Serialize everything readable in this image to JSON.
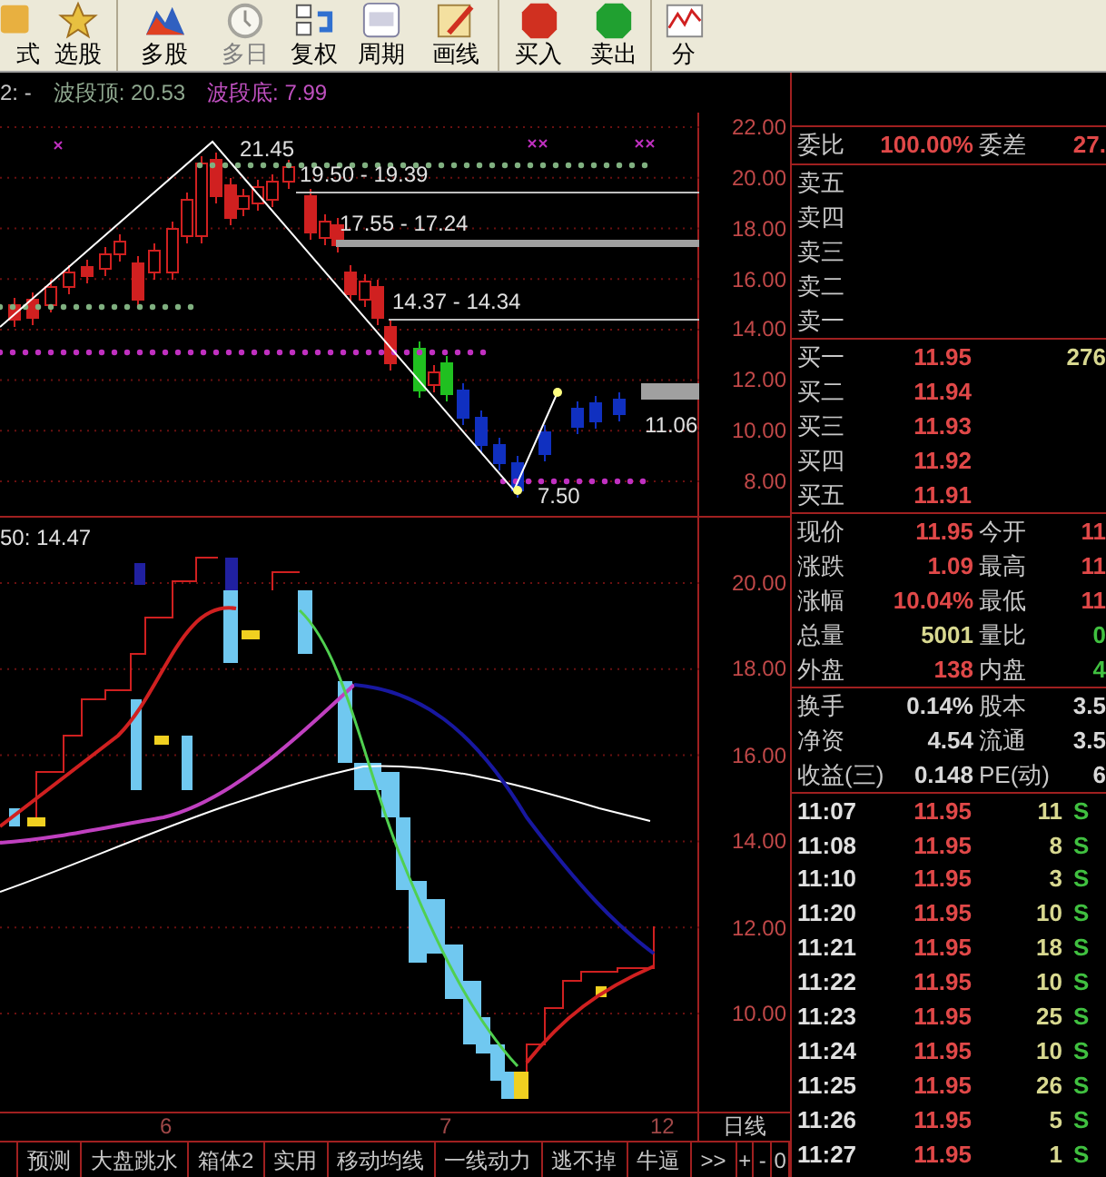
{
  "toolbar": [
    {
      "label": "式",
      "kind": "formula",
      "disabled": false
    },
    {
      "label": "选股",
      "kind": "pick",
      "disabled": false
    },
    {
      "label": "多股",
      "kind": "multi",
      "disabled": false
    },
    {
      "label": "多日",
      "kind": "days",
      "disabled": true
    },
    {
      "label": "复权",
      "kind": "restore",
      "disabled": false
    },
    {
      "label": "周期",
      "kind": "period",
      "disabled": false
    },
    {
      "label": "画线",
      "kind": "draw",
      "disabled": false
    },
    {
      "label": "买入",
      "kind": "buy",
      "disabled": false
    },
    {
      "label": "卖出",
      "kind": "sell",
      "disabled": false
    },
    {
      "label": "分",
      "kind": "timeshare",
      "disabled": false
    }
  ],
  "indicator_header": {
    "prefix": "2: -",
    "items": [
      {
        "label": "波段顶: 20.53",
        "color": "#8fa88f"
      },
      {
        "label": "波段底: 7.99",
        "color": "#c050c0"
      }
    ]
  },
  "price_chart": {
    "y_axis": [
      "22.00",
      "20.00",
      "18.00",
      "16.00",
      "14.00",
      "12.00",
      "10.00",
      "8.00"
    ],
    "labels": [
      {
        "text": "21.45"
      },
      {
        "text": "19.50 - 19.39"
      },
      {
        "text": "17.55 - 17.24"
      },
      {
        "text": "14.37 - 14.34"
      },
      {
        "text": "11.06"
      },
      {
        "text": "7.50"
      }
    ]
  },
  "ma_chart": {
    "header": "50: 14.47",
    "y_axis": [
      "20.00",
      "18.00",
      "16.00",
      "14.00",
      "12.00",
      "10.00"
    ],
    "x_axis": [
      "6",
      "7",
      "12"
    ]
  },
  "period": "日线",
  "tabs": [
    "预测",
    "大盘跳水",
    "箱体2",
    "实用",
    "移动均线",
    "一线动力",
    "逃不掉",
    "牛逼",
    ">>"
  ],
  "zoom_buttons": [
    "+",
    "-",
    "0"
  ],
  "quote": {
    "ratio": {
      "label": "委比",
      "value": "100.00%",
      "label2": "委差",
      "value2": "27."
    },
    "asks": [
      {
        "label": "卖五"
      },
      {
        "label": "卖四"
      },
      {
        "label": "卖三"
      },
      {
        "label": "卖二"
      },
      {
        "label": "卖一"
      }
    ],
    "bids": [
      {
        "label": "买一",
        "price": "11.95",
        "volume": "276"
      },
      {
        "label": "买二",
        "price": "11.94"
      },
      {
        "label": "买三",
        "price": "11.93"
      },
      {
        "label": "买四",
        "price": "11.92"
      },
      {
        "label": "买五",
        "price": "11.91"
      }
    ],
    "stats": [
      {
        "cells": [
          {
            "label": "现价",
            "value": "11.95",
            "color": "#e04848"
          },
          {
            "label": "今开",
            "value": "11",
            "color": "#e04848"
          }
        ]
      },
      {
        "cells": [
          {
            "label": "涨跌",
            "value": "1.09",
            "color": "#e04848"
          },
          {
            "label": "最高",
            "value": "11",
            "color": "#e04848"
          }
        ]
      },
      {
        "cells": [
          {
            "label": "涨幅",
            "value": "10.04%",
            "color": "#e04848"
          },
          {
            "label": "最低",
            "value": "11",
            "color": "#e04848"
          }
        ]
      },
      {
        "cells": [
          {
            "label": "总量",
            "value": "5001",
            "color": "#d8d890"
          },
          {
            "label": "量比",
            "value": "0",
            "color": "#40c040"
          }
        ]
      },
      {
        "cells": [
          {
            "label": "外盘",
            "value": "138",
            "color": "#e04848"
          },
          {
            "label": "内盘",
            "value": "4",
            "color": "#40c040"
          }
        ]
      }
    ],
    "finance": [
      {
        "label": "换手",
        "value": "0.14%",
        "label2": "股本",
        "value2": "3.5"
      },
      {
        "label": "净资",
        "value": "4.54",
        "label2": "流通",
        "value2": "3.5"
      },
      {
        "label": "收益(三)",
        "value": "0.148",
        "label2": "PE(动)",
        "value2": "6"
      }
    ],
    "trades": [
      {
        "time": "11:07",
        "price": "11.95",
        "volume": "11",
        "side": "S"
      },
      {
        "time": "11:08",
        "price": "11.95",
        "volume": "8",
        "side": "S"
      },
      {
        "time": "11:10",
        "price": "11.95",
        "volume": "3",
        "side": "S"
      },
      {
        "time": "11:20",
        "price": "11.95",
        "volume": "10",
        "side": "S"
      },
      {
        "time": "11:21",
        "price": "11.95",
        "volume": "18",
        "side": "S"
      },
      {
        "time": "11:22",
        "price": "11.95",
        "volume": "10",
        "side": "S"
      },
      {
        "time": "11:23",
        "price": "11.95",
        "volume": "25",
        "side": "S"
      },
      {
        "time": "11:24",
        "price": "11.95",
        "volume": "10",
        "side": "S"
      },
      {
        "time": "11:25",
        "price": "11.95",
        "volume": "26",
        "side": "S"
      },
      {
        "time": "11:26",
        "price": "11.95",
        "volume": "5",
        "side": "S"
      },
      {
        "time": "11:27",
        "price": "11.95",
        "volume": "1",
        "side": "S"
      }
    ]
  }
}
